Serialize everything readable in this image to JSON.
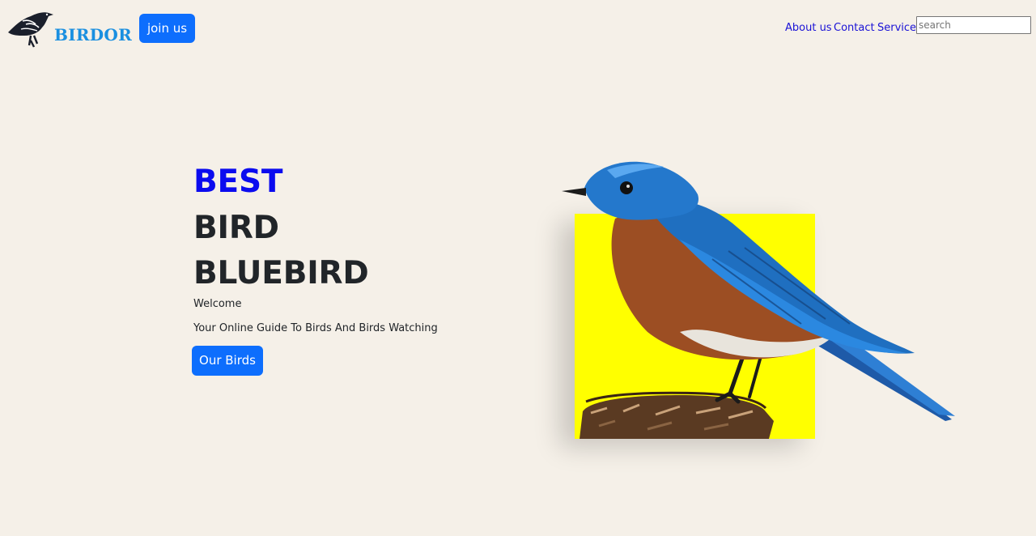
{
  "header": {
    "logo_text": "BIRDOR",
    "join_label": "join us",
    "nav": {
      "about": "About us",
      "contact": "Contact",
      "services": "Services"
    },
    "search": {
      "placeholder": "search",
      "value": ""
    }
  },
  "hero": {
    "line1": "BEST",
    "line2": "BIRD",
    "line3": "BLUEBIRD",
    "welcome": "Welcome",
    "tagline": "Your Online Guide To Birds And Birds Watching",
    "cta_label": "Our Birds"
  },
  "colors": {
    "background": "#f5f0e8",
    "accent_blue": "#0d6efd",
    "headline_blue": "#0b0bef",
    "nav_link": "#1a12d6",
    "highlight_yellow": "#ffff00"
  },
  "icons": {
    "logo": "crow-bird-logo-icon",
    "hero_image": "bluebird-on-stump-image"
  }
}
